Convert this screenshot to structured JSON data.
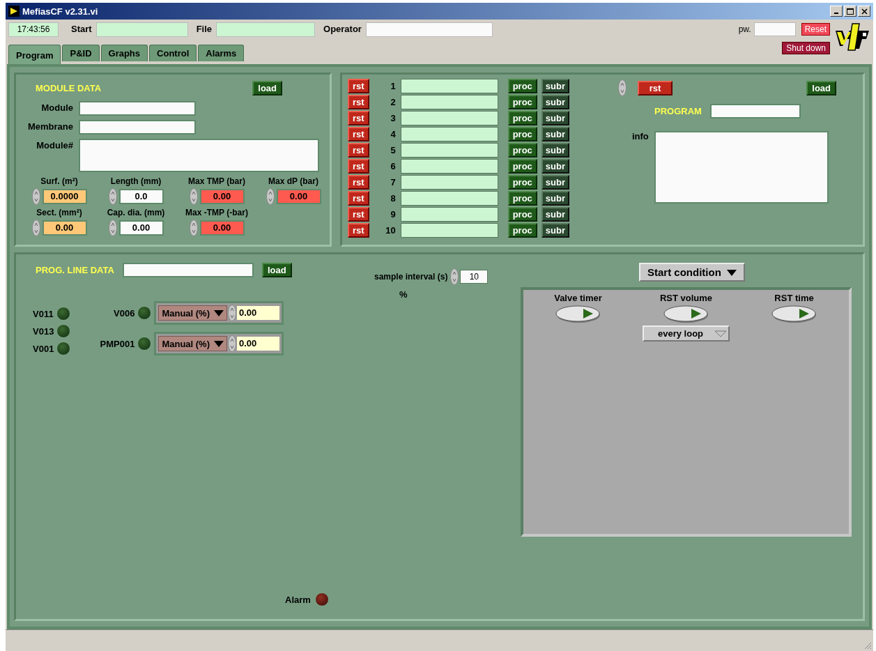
{
  "window": {
    "title": "MefiasCF v2.31.vi"
  },
  "header": {
    "time": "17:43:56",
    "fields": [
      {
        "label": "Start"
      },
      {
        "label": "File"
      },
      {
        "label": "Operator"
      }
    ],
    "password_label": "pw.",
    "reset": "Reset",
    "shutdown": "Shut down"
  },
  "tabs": [
    {
      "label": "Program",
      "selected": true
    },
    {
      "label": "P&ID",
      "selected": false
    },
    {
      "label": "Graphs",
      "selected": false
    },
    {
      "label": "Control",
      "selected": false
    },
    {
      "label": "Alarms",
      "selected": false
    }
  ],
  "module_data": {
    "title": "MODULE DATA",
    "load": "load",
    "text_fields": [
      {
        "label": "Module",
        "kind": "line"
      },
      {
        "label": "Membrane",
        "kind": "line"
      },
      {
        "label": "Module#",
        "kind": "area"
      }
    ],
    "numerics": [
      {
        "label": "Surf. (m²)",
        "value": "0.0000",
        "color": "#ffc878"
      },
      {
        "label": "Length (mm)",
        "value": "0.0",
        "color": "#fafafa"
      },
      {
        "label": "Max TMP (bar)",
        "value": "0.00",
        "color": "#ff5a50"
      },
      {
        "label": "Max dP (bar)",
        "value": "0.00",
        "color": "#ff5a50"
      },
      {
        "label": "Sect. (mm²)",
        "value": "0.00",
        "color": "#ffc878"
      },
      {
        "label": "Cap. dia. (mm)",
        "value": "0.00",
        "color": "#fafafa"
      },
      {
        "label": "Max -TMP (-bar)",
        "value": "0.00",
        "color": "#ff5a50"
      }
    ]
  },
  "program_lines": [
    {
      "reset": "rst",
      "number": "1",
      "proc": "proc",
      "subr": "subr"
    },
    {
      "reset": "rst",
      "number": "2",
      "proc": "proc",
      "subr": "subr"
    },
    {
      "reset": "rst",
      "number": "3",
      "proc": "proc",
      "subr": "subr"
    },
    {
      "reset": "rst",
      "number": "4",
      "proc": "proc",
      "subr": "subr"
    },
    {
      "reset": "rst",
      "number": "5",
      "proc": "proc",
      "subr": "subr"
    },
    {
      "reset": "rst",
      "number": "6",
      "proc": "proc",
      "subr": "subr"
    },
    {
      "reset": "rst",
      "number": "7",
      "proc": "proc",
      "subr": "subr"
    },
    {
      "reset": "rst",
      "number": "8",
      "proc": "proc",
      "subr": "subr"
    },
    {
      "reset": "rst",
      "number": "9",
      "proc": "proc",
      "subr": "subr"
    },
    {
      "reset": "rst",
      "number": "10",
      "proc": "proc",
      "subr": "subr"
    }
  ],
  "program": {
    "reset": "rst",
    "load": "load",
    "title": "PROGRAM",
    "info_label": "info"
  },
  "prog_line_data": {
    "title": "PROG. LINE DATA",
    "load": "load",
    "sample_interval_label": "sample interval (s)",
    "sample_interval": "10",
    "unit": "%",
    "valves": [
      {
        "label": "V011",
        "on": false
      },
      {
        "label": "V013",
        "on": false
      },
      {
        "label": "V001",
        "on": false
      }
    ],
    "outputs": [
      {
        "label": "V006",
        "on": false,
        "mode": "Manual (%)",
        "value": "0.00"
      },
      {
        "label": "PMP001",
        "on": false,
        "mode": "Manual (%)",
        "value": "0.00"
      }
    ],
    "alarm": {
      "label": "Alarm",
      "on": false
    }
  },
  "start_condition": {
    "selector": "Start condition",
    "switches": [
      {
        "label": "Valve timer",
        "on": false
      },
      {
        "label": "RST volume",
        "on": false
      },
      {
        "label": "RST time",
        "on": false
      }
    ],
    "loop_mode": "every loop"
  }
}
